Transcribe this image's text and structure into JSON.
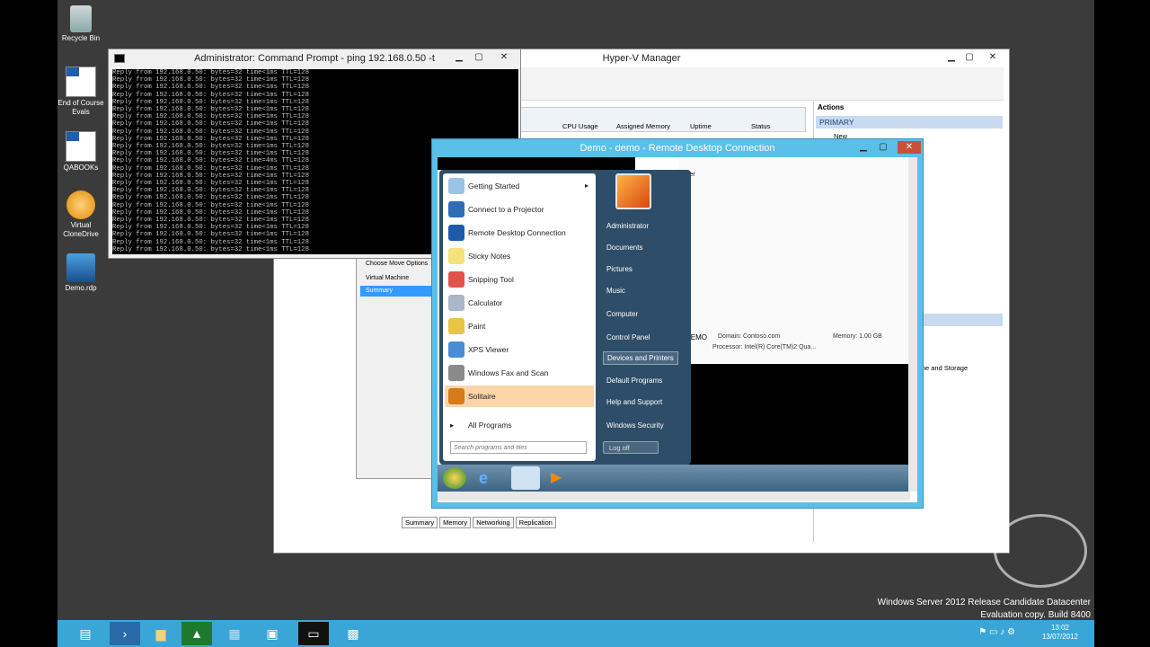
{
  "desktop_icons": [
    {
      "label": "Recycle Bin",
      "icon": "recycle-bin-icon"
    },
    {
      "label": "End of Course Evals",
      "icon": "qa-evals-icon"
    },
    {
      "label": "QABOOKs",
      "icon": "qa-books-icon"
    },
    {
      "label": "Virtual CloneDrive",
      "icon": "clonedrive-icon"
    },
    {
      "label": "Demo.rdp",
      "icon": "rdp-file-icon"
    }
  ],
  "cmd": {
    "title": "Administrator: Command Prompt - ping  192.168.0.50 -t",
    "output": "Reply from 192.168.0.50: bytes=32 time<1ms TTL=128\nReply from 192.168.0.50: bytes=32 time<1ms TTL=128\nReply from 192.168.0.50: bytes=32 time<1ms TTL=128\nReply from 192.168.0.50: bytes=32 time<1ms TTL=128\nReply from 192.168.0.50: bytes=32 time=1ms TTL=128\nReply from 192.168.0.50: bytes=32 time<1ms TTL=128\nReply from 192.168.0.50: bytes=32 time=1ms TTL=128\nReply from 192.168.0.50: bytes=32 time<1ms TTL=128\nReply from 192.168.0.50: bytes=32 time<1ms TTL=128\nReply from 192.168.0.50: bytes=32 time<1ms TTL=128\nReply from 192.168.0.50: bytes=32 time=1ms TTL=128\nReply from 192.168.0.50: bytes=32 time<1ms TTL=128\nReply from 192.168.0.50: bytes=32 time=4ms TTL=128\nReply from 192.168.0.50: bytes=32 time<1ms TTL=128\nReply from 192.168.0.50: bytes=32 time<1ms TTL=128\nReply from 192.168.0.50: bytes=32 time<1ms TTL=128\nReply from 192.168.0.50: bytes=32 time<1ms TTL=128\nReply from 192.168.0.50: bytes=32 time<1ms TTL=128\nReply from 192.168.0.50: bytes=32 time<1ms TTL=128\nReply from 192.168.0.50: bytes=32 time<1ms TTL=128\nReply from 192.168.0.50: bytes=32 time<1ms TTL=128\nReply from 192.168.0.50: bytes=32 time<1ms TTL=128\nReply from 192.168.0.50: bytes=32 time<1ms TTL=128\nReply from 192.168.0.50: bytes=32 time<1ms TTL=128\nReply from 192.168.0.50: bytes=32 time<1ms TTL=128"
  },
  "hyperv": {
    "title": "Hyper-V Manager",
    "columns": [
      "CPU Usage",
      "Assigned Memory",
      "Uptime",
      "Status"
    ],
    "actions_header": "Actions",
    "actions_section": "PRIMARY",
    "actions_new": "New",
    "right_text": "hine and Storage",
    "tabs": [
      "Summary",
      "Memory",
      "Networking",
      "Replication"
    ],
    "dialog_items": [
      "Choose Move Options",
      "Virtual Machine",
      "Summary"
    ],
    "summary": {
      "name": "DEMO",
      "domain": "Domain: Contoso.com",
      "processor": "Processor: Intel(R) Core(TM)2 Qua...",
      "memory": "Memory: 1.00 GB"
    },
    "partial_1": "ter",
    "partial_2": "rk"
  },
  "rdp": {
    "title": "Demo - demo - Remote Desktop Connection",
    "start_left": [
      "Getting Started",
      "Connect to a Projector",
      "Remote Desktop Connection",
      "Sticky Notes",
      "Snipping Tool",
      "Calculator",
      "Paint",
      "XPS Viewer",
      "Windows Fax and Scan",
      "Solitaire"
    ],
    "all_programs": "All Programs",
    "search_placeholder": "Search programs and files",
    "start_right": [
      "Administrator",
      "Documents",
      "Pictures",
      "Music",
      "Computer",
      "Control Panel",
      "Devices and Printers",
      "Default Programs",
      "Help and Support",
      "Windows Security"
    ],
    "logoff": "Log off"
  },
  "watermark": {
    "line1": "Windows Server 2012 Release Candidate Datacenter",
    "line2": "Evaluation copy. Build 8400"
  },
  "clock": {
    "time": "13:02",
    "date": "13/07/2012"
  }
}
